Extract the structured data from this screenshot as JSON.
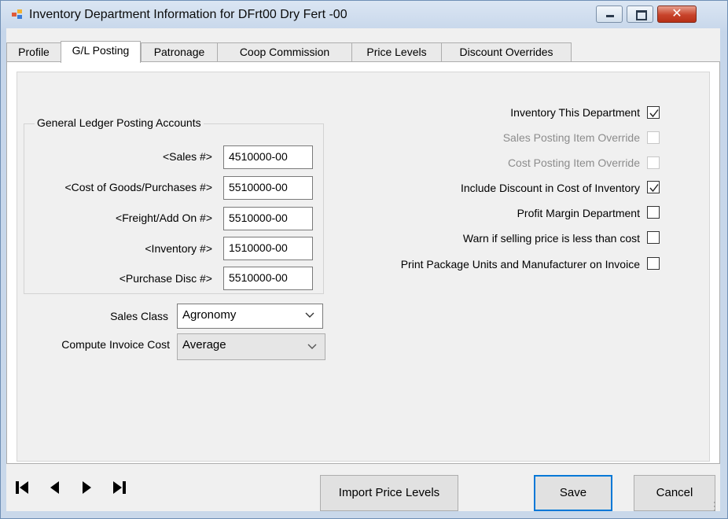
{
  "window": {
    "title": "Inventory Department Information for DFrt00  Dry Fert -00",
    "icon": "app-window-icon",
    "controls": [
      "minimize-icon",
      "maximize-icon",
      "close-icon"
    ]
  },
  "tabs": [
    {
      "label": "Profile",
      "active": false
    },
    {
      "label": "G/L Posting",
      "active": true
    },
    {
      "label": "Patronage",
      "active": false
    },
    {
      "label": "Coop Commission",
      "active": false
    },
    {
      "label": "Price Levels",
      "active": false
    },
    {
      "label": "Discount Overrides",
      "active": false
    }
  ],
  "gl_accounts": {
    "title": "General Ledger Posting Accounts",
    "fields": [
      {
        "label": "<Sales #>",
        "value": "4510000-00"
      },
      {
        "label": "<Cost of Goods/Purchases #>",
        "value": "5510000-00"
      },
      {
        "label": "<Freight/Add On #>",
        "value": "5510000-00"
      },
      {
        "label": "<Inventory #>",
        "value": "1510000-00"
      },
      {
        "label": "<Purchase Disc #>",
        "value": "5510000-00"
      }
    ]
  },
  "sales_class": {
    "label": "Sales Class",
    "value": "Agronomy"
  },
  "compute_invoice_cost": {
    "label": "Compute Invoice Cost",
    "value": "Average",
    "enabled": false
  },
  "options": [
    {
      "label": "Inventory This Department",
      "checked": true,
      "enabled": true
    },
    {
      "label": "Sales Posting Item Override",
      "checked": false,
      "enabled": false
    },
    {
      "label": "Cost Posting Item Override",
      "checked": false,
      "enabled": false
    },
    {
      "label": "Include Discount in Cost of Inventory",
      "checked": true,
      "enabled": true
    },
    {
      "label": "Profit Margin Department",
      "checked": false,
      "enabled": true
    },
    {
      "label": "Warn if selling price is less than cost",
      "checked": false,
      "enabled": true
    },
    {
      "label": "Print Package Units and Manufacturer on Invoice",
      "checked": false,
      "enabled": true
    }
  ],
  "navigation": [
    "first-record-icon",
    "previous-record-icon",
    "next-record-icon",
    "last-record-icon"
  ],
  "buttons": {
    "import_price_levels": "Import Price Levels",
    "save": "Save",
    "cancel": "Cancel"
  },
  "colors": {
    "title_bar": "#c6d6ea",
    "close_button": "#c8432b",
    "default_button_border": "#0078d7"
  }
}
